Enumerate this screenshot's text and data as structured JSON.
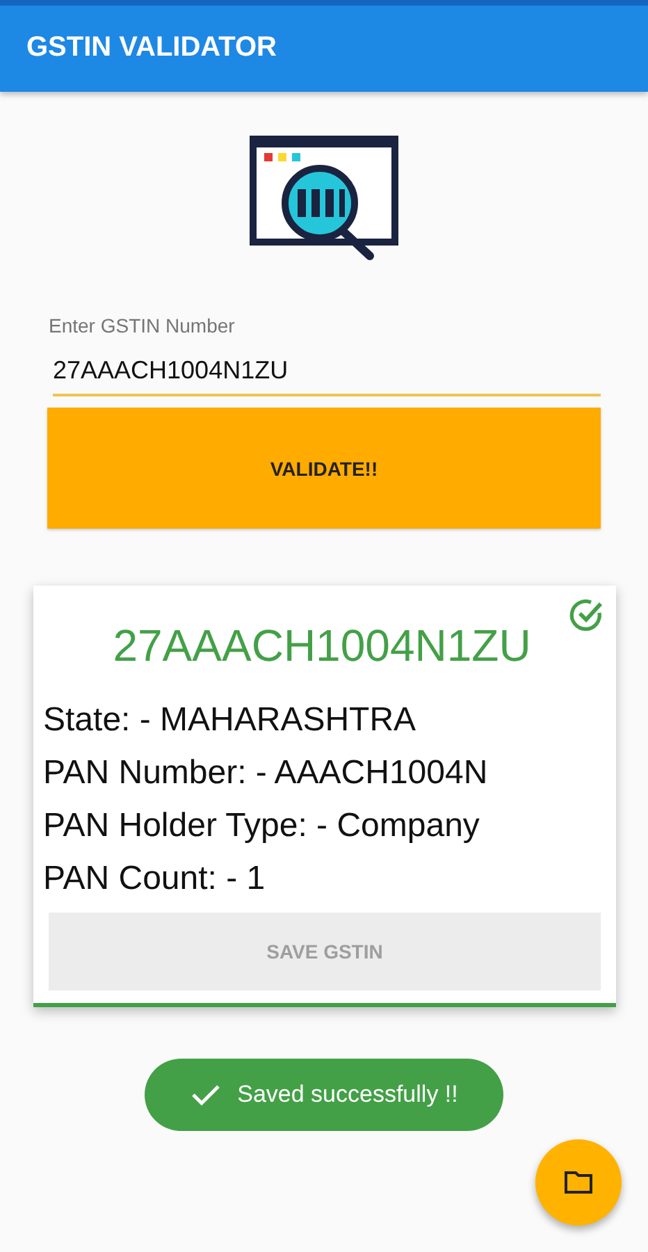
{
  "app_bar": {
    "title": "GSTIN VALIDATOR"
  },
  "form": {
    "label": "Enter GSTIN Number",
    "value": "27AAACH1004N1ZU",
    "button": "VALIDATE!!"
  },
  "result": {
    "valid": true,
    "gstin": "27AAACH1004N1ZU",
    "details": [
      "State: - MAHARASHTRA",
      "PAN Number: - AAACH1004N",
      "PAN Holder Type: - Company",
      "PAN Count: - 1"
    ],
    "save_button": {
      "label": "SAVE GSTIN",
      "disabled": true
    }
  },
  "toast": {
    "message": "Saved successfully !!"
  }
}
